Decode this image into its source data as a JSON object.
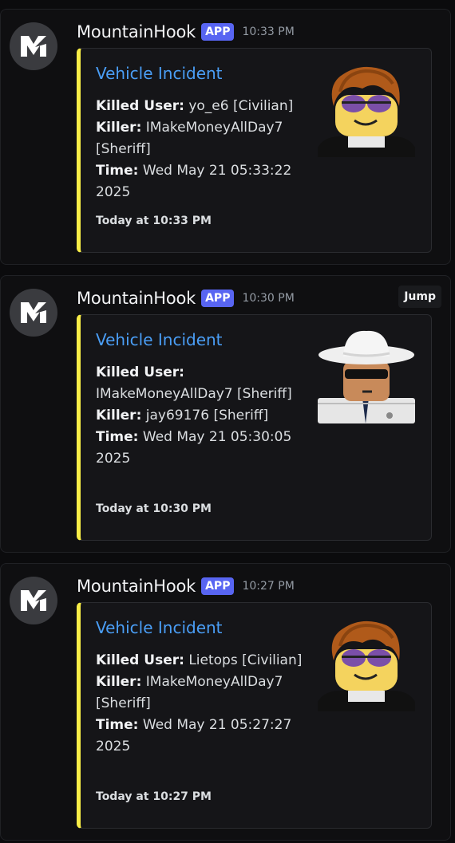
{
  "messages": [
    {
      "username": "MountainHook",
      "badge": "APP",
      "time": "10:33 PM",
      "embed": {
        "title": "Vehicle Incident",
        "killed_user_label": "Killed User:",
        "killed_user_value": "yo_e6 [Civilian]",
        "killer_label": "Killer:",
        "killer_value": "IMakeMoneyAllDay7 [Sheriff]",
        "time_label": "Time:",
        "time_value": "Wed May 21 05:33:22 2025",
        "footer": "Today at 10:33 PM",
        "thumbnail": "avatar-brown-hair-sunglasses"
      }
    },
    {
      "username": "MountainHook",
      "badge": "APP",
      "time": "10:30 PM",
      "jump": "Jump",
      "embed": {
        "title": "Vehicle Incident",
        "killed_user_label": "Killed User:",
        "killed_user_value": "IMakeMoneyAllDay7 [Sheriff]",
        "killer_label": "Killer:",
        "killer_value": "jay69176 [Sheriff]",
        "time_label": "Time:",
        "time_value": "Wed May 21 05:30:05 2025",
        "footer": "Today at 10:30 PM",
        "thumbnail": "avatar-cowboy-hat-sheriff"
      }
    },
    {
      "username": "MountainHook",
      "badge": "APP",
      "time": "10:27 PM",
      "embed": {
        "title": "Vehicle Incident",
        "killed_user_label": "Killed User:",
        "killed_user_value": "Lietops [Civilian]",
        "killer_label": "Killer:",
        "killer_value": "IMakeMoneyAllDay7 [Sheriff]",
        "time_label": "Time:",
        "time_value": "Wed May 21 05:27:27 2025",
        "footer": "Today at 10:27 PM",
        "thumbnail": "avatar-brown-hair-sunglasses"
      }
    }
  ],
  "colors": {
    "accent_bar": "#f8ed47",
    "title_link": "#4a9ef6",
    "app_badge": "#5865f2"
  }
}
